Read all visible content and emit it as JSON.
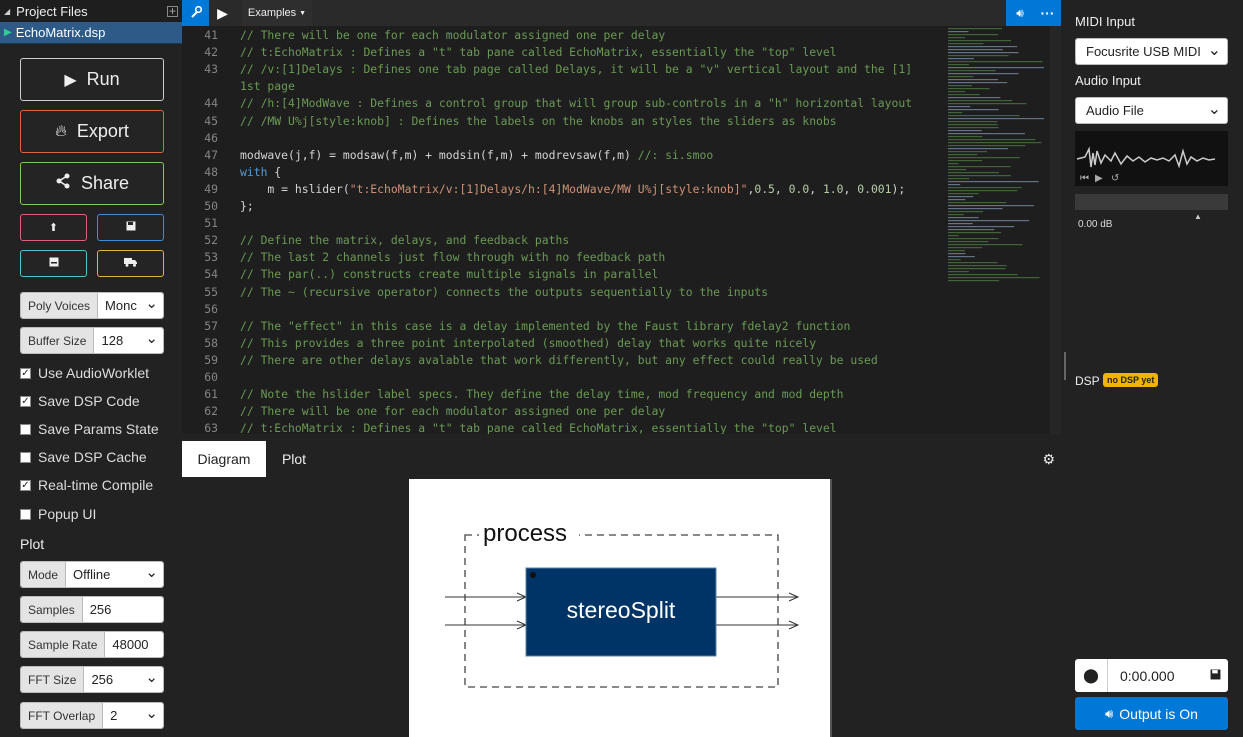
{
  "project_files": {
    "title": "Project Files",
    "file": "EchoMatrix.dsp"
  },
  "actions": {
    "run": "Run",
    "export": "Export",
    "share": "Share"
  },
  "small_icons": [
    "upload-icon",
    "save-icon",
    "save-local-icon",
    "truck-icon"
  ],
  "settings": {
    "poly_voices": {
      "label": "Poly Voices",
      "value": "Monc"
    },
    "buffer_size": {
      "label": "Buffer Size",
      "value": "128"
    }
  },
  "checkboxes": [
    {
      "label": "Use AudioWorklet",
      "checked": true
    },
    {
      "label": "Save DSP Code",
      "checked": true
    },
    {
      "label": "Save Params State",
      "checked": false
    },
    {
      "label": "Save DSP Cache",
      "checked": false
    },
    {
      "label": "Real-time Compile",
      "checked": true
    },
    {
      "label": "Popup UI",
      "checked": false
    }
  ],
  "plot": {
    "title": "Plot",
    "mode": {
      "label": "Mode",
      "value": "Offline"
    },
    "samples": {
      "label": "Samples",
      "value": "256"
    },
    "sample_rate": {
      "label": "Sample Rate",
      "value": "48000"
    },
    "fft_size": {
      "label": "FFT Size",
      "value": "256"
    },
    "fft_overlap": {
      "label": "FFT Overlap",
      "value": "2"
    }
  },
  "toolbar": {
    "examples": "Examples"
  },
  "code_lines": [
    {
      "n": "41",
      "segs": [
        {
          "c": "cm",
          "t": "// There will be one for each modulator assigned one per delay"
        }
      ]
    },
    {
      "n": "42",
      "segs": [
        {
          "c": "cm",
          "t": "// t:EchoMatrix : Defines a \"t\" tab pane called EchoMatrix, essentially the \"top\" level"
        }
      ]
    },
    {
      "n": "43",
      "segs": [
        {
          "c": "cm",
          "t": "// /v:[1]Delays : Defines one tab page called Delays, it will be a \"v\" vertical layout and the [1]"
        }
      ]
    },
    {
      "n": "",
      "segs": [
        {
          "c": "cm",
          "t": "1st page"
        }
      ]
    },
    {
      "n": "44",
      "segs": [
        {
          "c": "cm",
          "t": "// /h:[4]ModWave : Defines a control group that will group sub-controls in a \"h\" horizontal layout"
        }
      ]
    },
    {
      "n": "45",
      "segs": [
        {
          "c": "cm",
          "t": "// /MW U%j[style:knob] : Defines the labels on the knobs an styles the sliders as knobs"
        }
      ]
    },
    {
      "n": "46",
      "segs": []
    },
    {
      "n": "47",
      "segs": [
        {
          "c": "",
          "t": "modwave(j,f) = modsaw(f,m) + modsin(f,m) + modrevsaw(f,m) "
        },
        {
          "c": "cm",
          "t": "//: si.smoo"
        }
      ]
    },
    {
      "n": "48",
      "segs": [
        {
          "c": "kw",
          "t": "with"
        },
        {
          "c": "",
          "t": " {"
        }
      ]
    },
    {
      "n": "49",
      "segs": [
        {
          "c": "",
          "t": "    m = hslider("
        },
        {
          "c": "st",
          "t": "\"t:EchoMatrix/v:[1]Delays/h:[4]ModWave/MW U%j[style:knob]\""
        },
        {
          "c": "",
          "t": ","
        },
        {
          "c": "nu",
          "t": "0.5"
        },
        {
          "c": "",
          "t": ", "
        },
        {
          "c": "nu",
          "t": "0.0"
        },
        {
          "c": "",
          "t": ", "
        },
        {
          "c": "nu",
          "t": "1.0"
        },
        {
          "c": "",
          "t": ", "
        },
        {
          "c": "nu",
          "t": "0.001"
        },
        {
          "c": "",
          "t": ");"
        }
      ]
    },
    {
      "n": "50",
      "segs": [
        {
          "c": "",
          "t": "};"
        }
      ]
    },
    {
      "n": "51",
      "segs": []
    },
    {
      "n": "52",
      "segs": [
        {
          "c": "cm",
          "t": "// Define the matrix, delays, and feedback paths"
        }
      ]
    },
    {
      "n": "53",
      "segs": [
        {
          "c": "cm",
          "t": "// The last 2 channels just flow through with no feedback path"
        }
      ]
    },
    {
      "n": "54",
      "segs": [
        {
          "c": "cm",
          "t": "// The par(..) constructs create multiple signals in parallel"
        }
      ]
    },
    {
      "n": "55",
      "segs": [
        {
          "c": "cm",
          "t": "// The ~ (recursive operator) connects the outputs sequentially to the inputs"
        }
      ]
    },
    {
      "n": "56",
      "segs": []
    },
    {
      "n": "57",
      "segs": [
        {
          "c": "cm",
          "t": "// The \"effect\" in this case is a delay implemented by the Faust library fdelay2 function"
        }
      ]
    },
    {
      "n": "58",
      "segs": [
        {
          "c": "cm",
          "t": "// This provides a three point interpolated (smoothed) delay that works quite nicely"
        }
      ]
    },
    {
      "n": "59",
      "segs": [
        {
          "c": "cm",
          "t": "// There are other delays avalable that work differently, but any effect could really be used"
        }
      ]
    },
    {
      "n": "60",
      "segs": []
    },
    {
      "n": "61",
      "segs": [
        {
          "c": "cm",
          "t": "// Note the hslider label specs. They define the delay time, mod frequency and mod depth"
        }
      ]
    },
    {
      "n": "62",
      "segs": [
        {
          "c": "cm",
          "t": "// There will be one for each modulator assigned one per delay"
        }
      ]
    },
    {
      "n": "63",
      "segs": [
        {
          "c": "cm",
          "t": "// t:EchoMatrix : Defines a \"t\" tab pane called EchoMatrix, essentially the \"top\" level"
        }
      ]
    }
  ],
  "bottom_tabs": {
    "diagram": "Diagram",
    "plot": "Plot"
  },
  "diagram": {
    "group_label": "process",
    "block_label": "stereoSplit",
    "block_color": "#003366"
  },
  "right": {
    "midi_input_label": "MIDI Input",
    "midi_input_value": "Focusrite USB MIDI",
    "audio_input_label": "Audio Input",
    "audio_input_value": "Audio File",
    "db_value": "0.00 dB",
    "dsp_label": "DSP",
    "dsp_badge": "no DSP yet",
    "rec_time": "0:00.000",
    "output_button": "Output is On"
  },
  "colors": {
    "accent": "#0078d7",
    "run": "#cccccc",
    "export": "#e0643c",
    "share": "#7ccf4a",
    "upload": "#e0607a",
    "save": "#3a8fd8",
    "save_local": "#4fc3d0",
    "truck": "#e0b43c",
    "badge": "#f0b400"
  }
}
